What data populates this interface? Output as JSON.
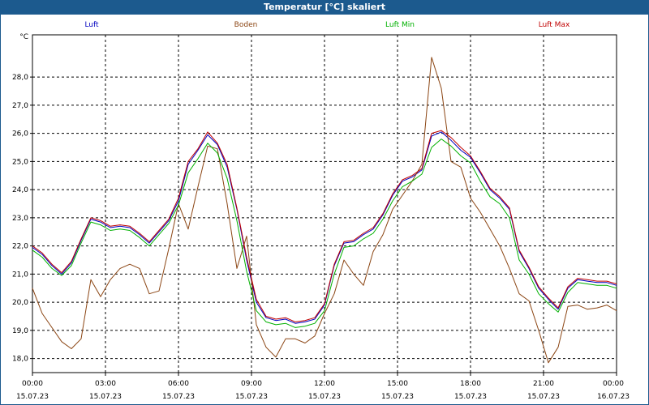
{
  "window": {
    "title": "Temperatur [°C] skaliert"
  },
  "chart_data": {
    "type": "line",
    "ylabel": "°C",
    "ylim": [
      17.5,
      29.5
    ],
    "yticks": [
      18.0,
      19.0,
      20.0,
      21.0,
      22.0,
      23.0,
      24.0,
      25.0,
      26.0,
      27.0,
      28.0
    ],
    "ytick_labels": [
      "18,0",
      "19,0",
      "20,0",
      "21,0",
      "22,0",
      "23,0",
      "24,0",
      "25,0",
      "26,0",
      "27,0",
      "28,0"
    ],
    "xlim": [
      0,
      24
    ],
    "xticks": [
      0,
      3,
      6,
      9,
      12,
      15,
      18,
      21,
      24
    ],
    "xtick_times": [
      "00:00",
      "03:00",
      "06:00",
      "09:00",
      "12:00",
      "15:00",
      "18:00",
      "21:00",
      "00:00"
    ],
    "xtick_dates": [
      "15.07.23",
      "15.07.23",
      "15.07.23",
      "15.07.23",
      "15.07.23",
      "15.07.23",
      "15.07.23",
      "15.07.23",
      "16.07.23"
    ],
    "grid": true,
    "legend_position": "top",
    "series": [
      {
        "name": "Luft",
        "color": "#0000c0",
        "x": [
          0,
          0.4,
          0.8,
          1.2,
          1.6,
          2.0,
          2.4,
          2.8,
          3.2,
          3.6,
          4.0,
          4.4,
          4.8,
          5.2,
          5.6,
          6.0,
          6.4,
          6.8,
          7.2,
          7.6,
          8.0,
          8.4,
          8.8,
          9.2,
          9.6,
          10.0,
          10.4,
          10.8,
          11.2,
          11.6,
          12.0,
          12.4,
          12.8,
          13.2,
          13.6,
          14.0,
          14.4,
          14.8,
          15.2,
          15.6,
          16.0,
          16.4,
          16.8,
          17.2,
          17.6,
          18.0,
          18.4,
          18.8,
          19.2,
          19.6,
          20.0,
          20.4,
          20.8,
          21.2,
          21.6,
          22.0,
          22.4,
          22.8,
          23.2,
          23.6,
          24.0
        ],
        "values": [
          21.95,
          21.7,
          21.3,
          21.0,
          21.4,
          22.2,
          22.95,
          22.85,
          22.65,
          22.7,
          22.65,
          22.4,
          22.1,
          22.5,
          22.9,
          23.6,
          24.9,
          25.4,
          25.95,
          25.6,
          24.8,
          23.3,
          21.5,
          20.0,
          19.45,
          19.35,
          19.4,
          19.25,
          19.3,
          19.4,
          19.9,
          21.3,
          22.1,
          22.15,
          22.4,
          22.6,
          23.1,
          23.8,
          24.3,
          24.45,
          24.7,
          25.9,
          26.05,
          25.75,
          25.4,
          25.15,
          24.6,
          24.0,
          23.7,
          23.3,
          21.8,
          21.2,
          20.5,
          20.1,
          19.75,
          20.5,
          20.8,
          20.75,
          20.7,
          20.7,
          20.6
        ]
      },
      {
        "name": "Boden",
        "color": "#8b4513",
        "x": [
          0,
          0.4,
          0.8,
          1.2,
          1.6,
          2.0,
          2.4,
          2.8,
          3.2,
          3.6,
          4.0,
          4.4,
          4.8,
          5.2,
          5.6,
          6.0,
          6.4,
          6.8,
          7.2,
          7.6,
          8.0,
          8.4,
          8.8,
          9.2,
          9.6,
          10.0,
          10.4,
          10.8,
          11.2,
          11.6,
          12.0,
          12.4,
          12.8,
          13.2,
          13.6,
          14.0,
          14.4,
          14.8,
          15.2,
          15.6,
          16.0,
          16.4,
          16.8,
          17.2,
          17.6,
          18.0,
          18.4,
          18.8,
          19.2,
          19.6,
          20.0,
          20.4,
          20.8,
          21.2,
          21.6,
          22.0,
          22.4,
          22.8,
          23.2,
          23.6,
          24.0
        ],
        "values": [
          20.5,
          19.6,
          19.1,
          18.6,
          18.35,
          18.7,
          20.8,
          20.2,
          20.8,
          21.2,
          21.35,
          21.2,
          20.3,
          20.4,
          21.9,
          23.5,
          22.6,
          24.1,
          25.55,
          25.45,
          23.5,
          21.2,
          22.35,
          19.2,
          18.4,
          18.05,
          18.7,
          18.7,
          18.55,
          18.8,
          19.6,
          20.3,
          21.5,
          21.0,
          20.6,
          21.8,
          22.4,
          23.3,
          23.8,
          24.3,
          24.9,
          28.7,
          27.6,
          25.0,
          24.8,
          23.7,
          23.2,
          22.6,
          22.0,
          21.2,
          20.3,
          20.05,
          19.0,
          17.85,
          18.4,
          19.85,
          19.9,
          19.75,
          19.8,
          19.9,
          19.7
        ]
      },
      {
        "name": "Luft Min",
        "color": "#00b000",
        "x": [
          0,
          0.4,
          0.8,
          1.2,
          1.6,
          2.0,
          2.4,
          2.8,
          3.2,
          3.6,
          4.0,
          4.4,
          4.8,
          5.2,
          5.6,
          6.0,
          6.4,
          6.8,
          7.2,
          7.6,
          8.0,
          8.4,
          8.8,
          9.2,
          9.6,
          10.0,
          10.4,
          10.8,
          11.2,
          11.6,
          12.0,
          12.4,
          12.8,
          13.2,
          13.6,
          14.0,
          14.4,
          14.8,
          15.2,
          15.6,
          16.0,
          16.4,
          16.8,
          17.2,
          17.6,
          18.0,
          18.4,
          18.8,
          19.2,
          19.6,
          20.0,
          20.4,
          20.8,
          21.2,
          21.6,
          22.0,
          22.4,
          22.8,
          23.2,
          23.6,
          24.0
        ],
        "values": [
          21.85,
          21.6,
          21.2,
          20.95,
          21.3,
          22.1,
          22.85,
          22.75,
          22.55,
          22.6,
          22.55,
          22.3,
          22.0,
          22.4,
          22.8,
          23.45,
          24.6,
          25.1,
          25.65,
          25.3,
          24.4,
          22.9,
          21.1,
          19.7,
          19.3,
          19.2,
          19.25,
          19.1,
          19.15,
          19.25,
          19.7,
          21.0,
          21.95,
          22.0,
          22.25,
          22.45,
          22.95,
          23.6,
          24.1,
          24.3,
          24.55,
          25.5,
          25.8,
          25.55,
          25.2,
          24.95,
          24.3,
          23.75,
          23.5,
          23.0,
          21.5,
          21.0,
          20.3,
          19.95,
          19.65,
          20.35,
          20.7,
          20.65,
          20.6,
          20.6,
          20.5
        ]
      },
      {
        "name": "Luft Max",
        "color": "#c00000",
        "x": [
          0,
          0.4,
          0.8,
          1.2,
          1.6,
          2.0,
          2.4,
          2.8,
          3.2,
          3.6,
          4.0,
          4.4,
          4.8,
          5.2,
          5.6,
          6.0,
          6.4,
          6.8,
          7.2,
          7.6,
          8.0,
          8.4,
          8.8,
          9.2,
          9.6,
          10.0,
          10.4,
          10.8,
          11.2,
          11.6,
          12.0,
          12.4,
          12.8,
          13.2,
          13.6,
          14.0,
          14.4,
          14.8,
          15.2,
          15.6,
          16.0,
          16.4,
          16.8,
          17.2,
          17.6,
          18.0,
          18.4,
          18.8,
          19.2,
          19.6,
          20.0,
          20.4,
          20.8,
          21.2,
          21.6,
          22.0,
          22.4,
          22.8,
          23.2,
          23.6,
          24.0
        ],
        "values": [
          22.0,
          21.75,
          21.35,
          21.05,
          21.45,
          22.25,
          23.0,
          22.9,
          22.7,
          22.75,
          22.7,
          22.45,
          22.15,
          22.55,
          22.95,
          23.7,
          25.0,
          25.45,
          26.05,
          25.65,
          24.9,
          23.35,
          21.6,
          20.1,
          19.5,
          19.4,
          19.45,
          19.3,
          19.35,
          19.45,
          19.95,
          21.35,
          22.15,
          22.2,
          22.45,
          22.65,
          23.15,
          23.85,
          24.35,
          24.5,
          24.75,
          26.0,
          26.1,
          25.85,
          25.5,
          25.2,
          24.65,
          24.05,
          23.75,
          23.35,
          21.85,
          21.25,
          20.55,
          20.15,
          19.8,
          20.55,
          20.85,
          20.8,
          20.75,
          20.75,
          20.65
        ]
      }
    ]
  }
}
